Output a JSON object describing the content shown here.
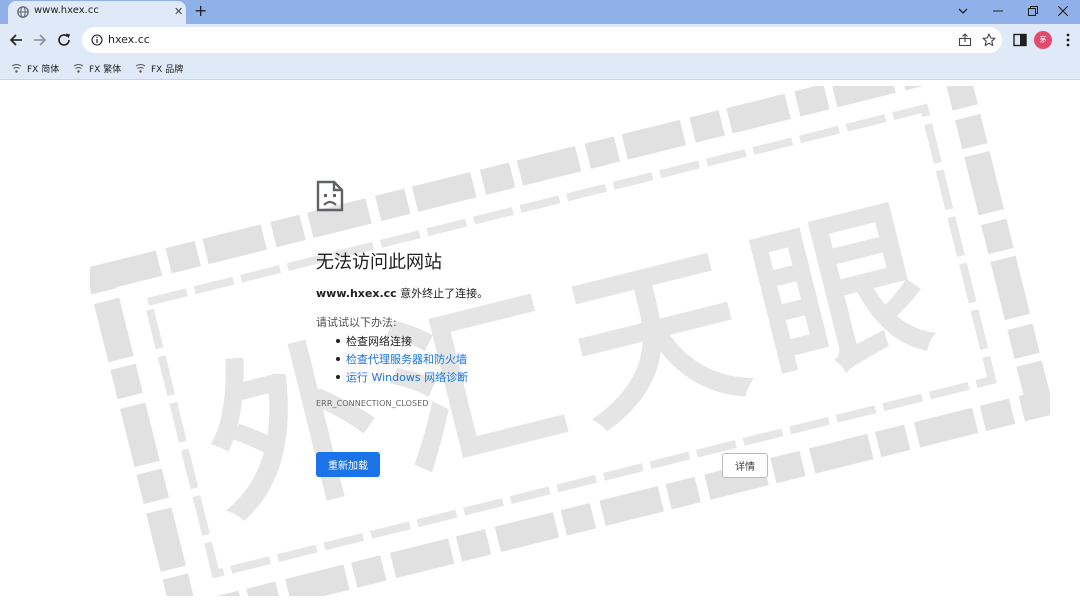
{
  "browser": {
    "tab": {
      "title": "www.hxex.cc",
      "close_glyph": "✕"
    },
    "new_tab_glyph": "+",
    "window_controls": [
      "chevron-down-icon",
      "minimize-icon",
      "restore-icon",
      "close-icon"
    ],
    "address_bar": {
      "url": "hxex.cc"
    },
    "profile_avatar_text": "茅",
    "bookmarks": [
      {
        "label": "FX 简体"
      },
      {
        "label": "FX 繁体"
      },
      {
        "label": "FX 品牌"
      }
    ]
  },
  "error_page": {
    "title": "无法访问此网站",
    "host": "www.hxex.cc",
    "description_suffix": " 意外终止了连接。",
    "try_label": "请试试以下办法:",
    "suggestions": [
      {
        "text": "检查网络连接",
        "is_link": false
      },
      {
        "text": "检查代理服务器和防火墙",
        "is_link": true
      },
      {
        "text": "运行 Windows 网络诊断",
        "is_link": true
      }
    ],
    "error_code": "ERR_CONNECTION_CLOSED",
    "reload_button": "重新加载",
    "details_button": "详情"
  },
  "watermark": {
    "text": "外汇天眼"
  },
  "colors": {
    "tab_strip": "#8fb0e8",
    "toolbar": "#dfe9f8",
    "primary_button": "#1a73e8",
    "link": "#1a73e8",
    "avatar": "#e34a6f",
    "watermark": "#c9c9c9"
  }
}
